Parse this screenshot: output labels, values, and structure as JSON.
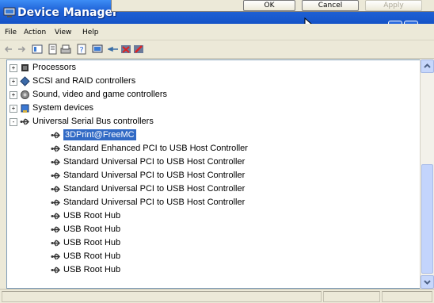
{
  "window": {
    "title": "Device Manager"
  },
  "dialog": {
    "ok_label": "OK",
    "cancel_label": "Cancel",
    "apply_label": "Apply"
  },
  "menu": {
    "items": [
      "File",
      "Action",
      "View",
      "Help"
    ]
  },
  "tree": {
    "rows": [
      {
        "label": "Processors",
        "icon": "processor-icon",
        "expander": "+",
        "level": 0
      },
      {
        "label": "SCSI and RAID controllers",
        "icon": "scsi-controller-icon",
        "expander": "+",
        "level": 0
      },
      {
        "label": "Sound, video and game controllers",
        "icon": "sound-icon",
        "expander": "+",
        "level": 0
      },
      {
        "label": "System devices",
        "icon": "system-devices-icon",
        "expander": "+",
        "level": 0
      },
      {
        "label": "Universal Serial Bus controllers",
        "icon": "usb-icon",
        "expander": "-",
        "level": 0
      },
      {
        "label": "3DPrint@FreeMC",
        "icon": "usb-icon",
        "level": 1,
        "selected": true
      },
      {
        "label": "Standard Enhanced PCI to USB Host Controller",
        "icon": "usb-icon",
        "level": 1
      },
      {
        "label": "Standard Universal PCI to USB Host Controller",
        "icon": "usb-icon",
        "level": 1
      },
      {
        "label": "Standard Universal PCI to USB Host Controller",
        "icon": "usb-icon",
        "level": 1
      },
      {
        "label": "Standard Universal PCI to USB Host Controller",
        "icon": "usb-icon",
        "level": 1
      },
      {
        "label": "Standard Universal PCI to USB Host Controller",
        "icon": "usb-icon",
        "level": 1
      },
      {
        "label": "USB Root Hub",
        "icon": "usb-icon",
        "level": 1
      },
      {
        "label": "USB Root Hub",
        "icon": "usb-icon",
        "level": 1
      },
      {
        "label": "USB Root Hub",
        "icon": "usb-icon",
        "level": 1
      },
      {
        "label": "USB Root Hub",
        "icon": "usb-icon",
        "level": 1
      },
      {
        "label": "USB Root Hub",
        "icon": "usb-icon",
        "level": 1
      }
    ]
  },
  "colors": {
    "title_bar": "#1f62d6",
    "selection": "#316ac5",
    "window_bg": "#ece9d8"
  }
}
